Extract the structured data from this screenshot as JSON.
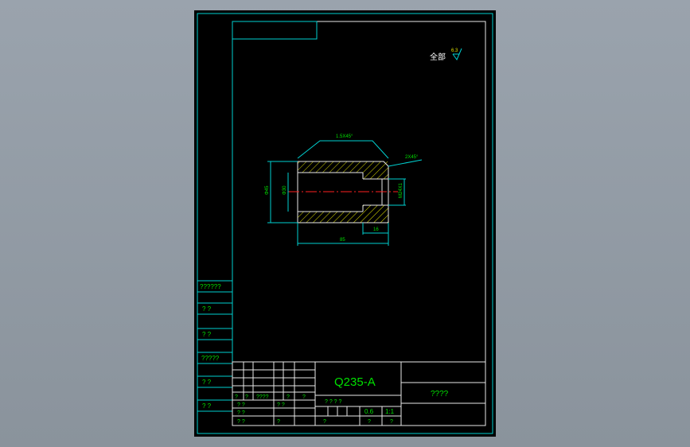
{
  "drawing": {
    "surface_note_label": "全部",
    "surface_roughness": "6.3",
    "dimensions": {
      "top_chamfer": "1.5X45°",
      "right_chamfer": "2X45°",
      "outer_diameter": "Φ45",
      "inner_diameter": "Φ30",
      "thread": "M24X1",
      "length_total": "85",
      "length_thread": "16"
    }
  },
  "title_block": {
    "material": "Q235-A",
    "part_name": "????",
    "scale": "0.6",
    "ratio": "1:1",
    "row_marks": [
      "? ?",
      "? ?",
      "? ?",
      "? ?",
      "?"
    ],
    "left_strip": [
      "??????",
      "?  ?",
      "?  ?",
      "?????",
      "?  ?",
      "?  ?"
    ],
    "sign_row": [
      "?",
      "?",
      "????",
      "?",
      "?"
    ],
    "bottom_cells": [
      "? ? ? ?",
      "?",
      "?",
      "?"
    ]
  },
  "colors": {
    "frame": "#00d0d0",
    "text_green": "#00e000",
    "text_white": "#ffffff",
    "hatch": "#e0e000",
    "centerline": "#ff2020"
  }
}
